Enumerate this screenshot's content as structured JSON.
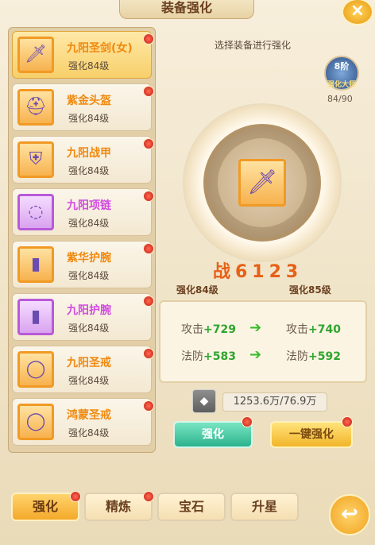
{
  "title": "装备强化",
  "close_icon": "close-icon",
  "back_icon": "back-arrow-icon",
  "list": [
    {
      "name": "九阳圣剑(女)",
      "level": "强化84级",
      "color": "orange",
      "icon": "sword-icon",
      "selected": true
    },
    {
      "name": "紫金头盔",
      "level": "强化84级",
      "color": "orange",
      "icon": "helmet-icon",
      "selected": false
    },
    {
      "name": "九阳战甲",
      "level": "强化84级",
      "color": "orange",
      "icon": "armor-icon",
      "selected": false
    },
    {
      "name": "九阳项链",
      "level": "强化84级",
      "color": "purple",
      "icon": "necklace-icon",
      "selected": false
    },
    {
      "name": "紫华护腕",
      "level": "强化84级",
      "color": "orange",
      "icon": "bracer-icon",
      "selected": false
    },
    {
      "name": "九阳护腕",
      "level": "强化84级",
      "color": "purple",
      "icon": "bracer-icon",
      "selected": false
    },
    {
      "name": "九阳圣戒",
      "level": "强化84级",
      "color": "orange",
      "icon": "ring-icon",
      "selected": false
    },
    {
      "name": "鸿蒙圣戒",
      "level": "强化84级",
      "color": "orange",
      "icon": "ring-icon",
      "selected": false
    }
  ],
  "right": {
    "hint": "选择装备进行强化",
    "master": {
      "rank": "8阶",
      "label": "强化大师",
      "count": "84/90"
    },
    "power": "战6123",
    "level_from": "强化84级",
    "level_to": "强化85级",
    "stats": [
      {
        "name": "攻击",
        "from": "+729",
        "to": "+740"
      },
      {
        "name": "法防",
        "from": "+583",
        "to": "+592"
      }
    ],
    "currency": "1253.6万/76.9万",
    "btn_strengthen": "强化",
    "btn_auto": "一键强化"
  },
  "tabs": [
    "强化",
    "精炼",
    "宝石",
    "升星"
  ]
}
